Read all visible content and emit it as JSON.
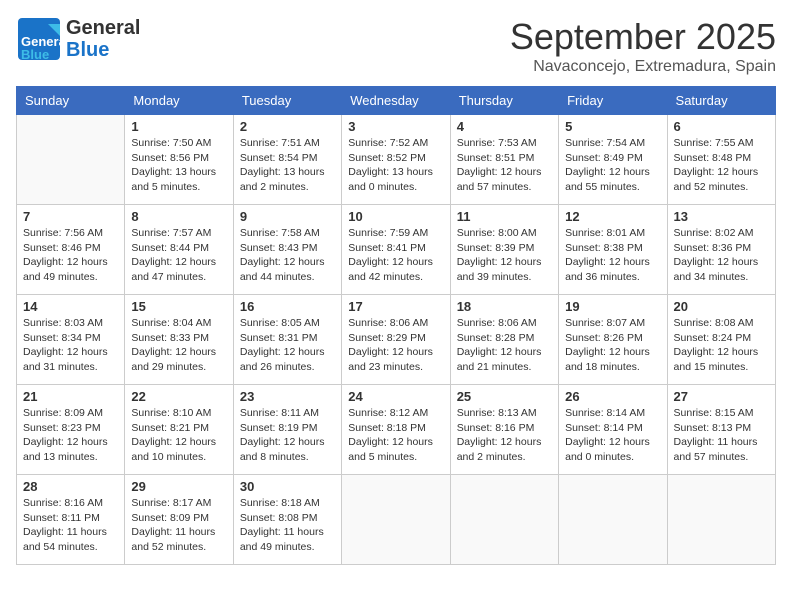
{
  "header": {
    "logo": {
      "general": "General",
      "blue": "Blue"
    },
    "month": "September 2025",
    "location": "Navaconcejo, Extremadura, Spain"
  },
  "weekdays": [
    "Sunday",
    "Monday",
    "Tuesday",
    "Wednesday",
    "Thursday",
    "Friday",
    "Saturday"
  ],
  "weeks": [
    [
      {
        "day": "",
        "sunrise": "",
        "sunset": "",
        "daylight": ""
      },
      {
        "day": "1",
        "sunrise": "Sunrise: 7:50 AM",
        "sunset": "Sunset: 8:56 PM",
        "daylight": "Daylight: 13 hours and 5 minutes."
      },
      {
        "day": "2",
        "sunrise": "Sunrise: 7:51 AM",
        "sunset": "Sunset: 8:54 PM",
        "daylight": "Daylight: 13 hours and 2 minutes."
      },
      {
        "day": "3",
        "sunrise": "Sunrise: 7:52 AM",
        "sunset": "Sunset: 8:52 PM",
        "daylight": "Daylight: 13 hours and 0 minutes."
      },
      {
        "day": "4",
        "sunrise": "Sunrise: 7:53 AM",
        "sunset": "Sunset: 8:51 PM",
        "daylight": "Daylight: 12 hours and 57 minutes."
      },
      {
        "day": "5",
        "sunrise": "Sunrise: 7:54 AM",
        "sunset": "Sunset: 8:49 PM",
        "daylight": "Daylight: 12 hours and 55 minutes."
      },
      {
        "day": "6",
        "sunrise": "Sunrise: 7:55 AM",
        "sunset": "Sunset: 8:48 PM",
        "daylight": "Daylight: 12 hours and 52 minutes."
      }
    ],
    [
      {
        "day": "7",
        "sunrise": "Sunrise: 7:56 AM",
        "sunset": "Sunset: 8:46 PM",
        "daylight": "Daylight: 12 hours and 49 minutes."
      },
      {
        "day": "8",
        "sunrise": "Sunrise: 7:57 AM",
        "sunset": "Sunset: 8:44 PM",
        "daylight": "Daylight: 12 hours and 47 minutes."
      },
      {
        "day": "9",
        "sunrise": "Sunrise: 7:58 AM",
        "sunset": "Sunset: 8:43 PM",
        "daylight": "Daylight: 12 hours and 44 minutes."
      },
      {
        "day": "10",
        "sunrise": "Sunrise: 7:59 AM",
        "sunset": "Sunset: 8:41 PM",
        "daylight": "Daylight: 12 hours and 42 minutes."
      },
      {
        "day": "11",
        "sunrise": "Sunrise: 8:00 AM",
        "sunset": "Sunset: 8:39 PM",
        "daylight": "Daylight: 12 hours and 39 minutes."
      },
      {
        "day": "12",
        "sunrise": "Sunrise: 8:01 AM",
        "sunset": "Sunset: 8:38 PM",
        "daylight": "Daylight: 12 hours and 36 minutes."
      },
      {
        "day": "13",
        "sunrise": "Sunrise: 8:02 AM",
        "sunset": "Sunset: 8:36 PM",
        "daylight": "Daylight: 12 hours and 34 minutes."
      }
    ],
    [
      {
        "day": "14",
        "sunrise": "Sunrise: 8:03 AM",
        "sunset": "Sunset: 8:34 PM",
        "daylight": "Daylight: 12 hours and 31 minutes."
      },
      {
        "day": "15",
        "sunrise": "Sunrise: 8:04 AM",
        "sunset": "Sunset: 8:33 PM",
        "daylight": "Daylight: 12 hours and 29 minutes."
      },
      {
        "day": "16",
        "sunrise": "Sunrise: 8:05 AM",
        "sunset": "Sunset: 8:31 PM",
        "daylight": "Daylight: 12 hours and 26 minutes."
      },
      {
        "day": "17",
        "sunrise": "Sunrise: 8:06 AM",
        "sunset": "Sunset: 8:29 PM",
        "daylight": "Daylight: 12 hours and 23 minutes."
      },
      {
        "day": "18",
        "sunrise": "Sunrise: 8:06 AM",
        "sunset": "Sunset: 8:28 PM",
        "daylight": "Daylight: 12 hours and 21 minutes."
      },
      {
        "day": "19",
        "sunrise": "Sunrise: 8:07 AM",
        "sunset": "Sunset: 8:26 PM",
        "daylight": "Daylight: 12 hours and 18 minutes."
      },
      {
        "day": "20",
        "sunrise": "Sunrise: 8:08 AM",
        "sunset": "Sunset: 8:24 PM",
        "daylight": "Daylight: 12 hours and 15 minutes."
      }
    ],
    [
      {
        "day": "21",
        "sunrise": "Sunrise: 8:09 AM",
        "sunset": "Sunset: 8:23 PM",
        "daylight": "Daylight: 12 hours and 13 minutes."
      },
      {
        "day": "22",
        "sunrise": "Sunrise: 8:10 AM",
        "sunset": "Sunset: 8:21 PM",
        "daylight": "Daylight: 12 hours and 10 minutes."
      },
      {
        "day": "23",
        "sunrise": "Sunrise: 8:11 AM",
        "sunset": "Sunset: 8:19 PM",
        "daylight": "Daylight: 12 hours and 8 minutes."
      },
      {
        "day": "24",
        "sunrise": "Sunrise: 8:12 AM",
        "sunset": "Sunset: 8:18 PM",
        "daylight": "Daylight: 12 hours and 5 minutes."
      },
      {
        "day": "25",
        "sunrise": "Sunrise: 8:13 AM",
        "sunset": "Sunset: 8:16 PM",
        "daylight": "Daylight: 12 hours and 2 minutes."
      },
      {
        "day": "26",
        "sunrise": "Sunrise: 8:14 AM",
        "sunset": "Sunset: 8:14 PM",
        "daylight": "Daylight: 12 hours and 0 minutes."
      },
      {
        "day": "27",
        "sunrise": "Sunrise: 8:15 AM",
        "sunset": "Sunset: 8:13 PM",
        "daylight": "Daylight: 11 hours and 57 minutes."
      }
    ],
    [
      {
        "day": "28",
        "sunrise": "Sunrise: 8:16 AM",
        "sunset": "Sunset: 8:11 PM",
        "daylight": "Daylight: 11 hours and 54 minutes."
      },
      {
        "day": "29",
        "sunrise": "Sunrise: 8:17 AM",
        "sunset": "Sunset: 8:09 PM",
        "daylight": "Daylight: 11 hours and 52 minutes."
      },
      {
        "day": "30",
        "sunrise": "Sunrise: 8:18 AM",
        "sunset": "Sunset: 8:08 PM",
        "daylight": "Daylight: 11 hours and 49 minutes."
      },
      {
        "day": "",
        "sunrise": "",
        "sunset": "",
        "daylight": ""
      },
      {
        "day": "",
        "sunrise": "",
        "sunset": "",
        "daylight": ""
      },
      {
        "day": "",
        "sunrise": "",
        "sunset": "",
        "daylight": ""
      },
      {
        "day": "",
        "sunrise": "",
        "sunset": "",
        "daylight": ""
      }
    ]
  ]
}
